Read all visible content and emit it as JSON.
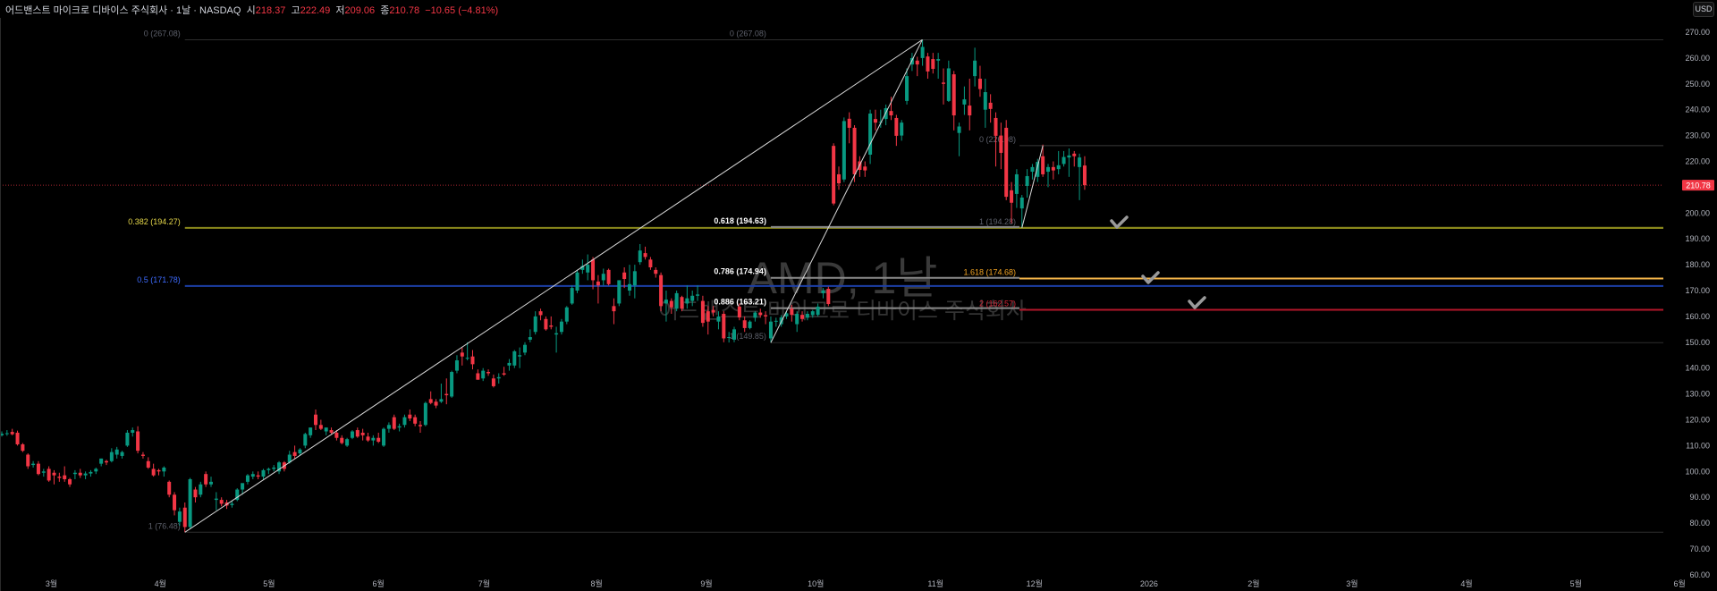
{
  "header": {
    "title": "어드밴스트 마이크로 디바이스 주식회사 · 1날 · NASDAQ",
    "open_label": "시",
    "open": "218.37",
    "high_label": "고",
    "high": "222.49",
    "low_label": "저",
    "low": "209.06",
    "close_label": "종",
    "close": "210.78",
    "change": "−10.65 (−4.81%)"
  },
  "currency_button": "USD",
  "watermark": {
    "symbol": "AMD, 1날",
    "name": "어드밴스트 마이크로 디바이스 주식회사"
  },
  "colors": {
    "up": "#089981",
    "down": "#f23645",
    "background": "#000000"
  },
  "chart_data": {
    "type": "candlestick",
    "symbol": "AMD",
    "interval": "1D",
    "exchange": "NASDAQ",
    "ylim": [
      60,
      270
    ],
    "y_ticks": [
      "270.00",
      "260.00",
      "250.00",
      "240.00",
      "230.00",
      "220.00",
      "210.00",
      "200.00",
      "190.00",
      "180.00",
      "170.00",
      "160.00",
      "150.00",
      "140.00",
      "130.00",
      "120.00",
      "110.00",
      "100.00",
      "90.00",
      "80.00",
      "70.00",
      "60.00"
    ],
    "x_ticks": [
      {
        "label": "3월",
        "index": 9.5
      },
      {
        "label": "4월",
        "index": 30.3
      },
      {
        "label": "5월",
        "index": 51.1
      },
      {
        "label": "6월",
        "index": 72
      },
      {
        "label": "7월",
        "index": 92.2
      },
      {
        "label": "8월",
        "index": 113.7
      },
      {
        "label": "9월",
        "index": 134.7
      },
      {
        "label": "10월",
        "index": 155.6
      },
      {
        "label": "11월",
        "index": 178.5
      },
      {
        "label": "12월",
        "index": 197.4
      },
      {
        "label": "2026",
        "index": 219.3
      },
      {
        "label": "2월",
        "index": 239.3
      },
      {
        "label": "3월",
        "index": 258.1
      },
      {
        "label": "4월",
        "index": 280
      },
      {
        "label": "5월",
        "index": 300.9
      },
      {
        "label": "6월",
        "index": 320.7
      }
    ],
    "last_price": "210.78",
    "candles_ohlc": [
      [
        114,
        115.5,
        113.5,
        114.6
      ],
      [
        114.6,
        116,
        113.8,
        114.8
      ],
      [
        115.3,
        116.5,
        114,
        114.4
      ],
      [
        115,
        115.8,
        110,
        110.5
      ],
      [
        110.5,
        111,
        107.5,
        108
      ],
      [
        106.5,
        107,
        101,
        102
      ],
      [
        102.5,
        104,
        101.5,
        103
      ],
      [
        103,
        104,
        98.5,
        99
      ],
      [
        99.5,
        101,
        98,
        100
      ],
      [
        101,
        102,
        96,
        96.5
      ],
      [
        99.5,
        100.5,
        95,
        98.5
      ],
      [
        98,
        99.5,
        96,
        97.5
      ],
      [
        98.5,
        102,
        96,
        97
      ],
      [
        97,
        97.5,
        94,
        95
      ],
      [
        99,
        100.5,
        97,
        99.5
      ],
      [
        99.5,
        101,
        97.5,
        98.5
      ],
      [
        98.5,
        100,
        97,
        99.2
      ],
      [
        99.2,
        100.5,
        98,
        99.8
      ],
      [
        100,
        101.5,
        99,
        101
      ],
      [
        103,
        105,
        102,
        105
      ],
      [
        104,
        104.5,
        102.5,
        103.5
      ],
      [
        104,
        109,
        103.5,
        107.5
      ],
      [
        106.5,
        109.5,
        105,
        108.5
      ],
      [
        106,
        108,
        105,
        107.5
      ],
      [
        110,
        116,
        109.5,
        115
      ],
      [
        115,
        117,
        113.5,
        116
      ],
      [
        115.5,
        117.5,
        107,
        108
      ],
      [
        106.5,
        107.5,
        105,
        106
      ],
      [
        104,
        105.5,
        101,
        101.5
      ],
      [
        101,
        103,
        98,
        98.5
      ],
      [
        100.5,
        101,
        98.5,
        100
      ],
      [
        100,
        102,
        98,
        101.5
      ],
      [
        96,
        96.5,
        90,
        91
      ],
      [
        91,
        92,
        83,
        85
      ],
      [
        80.5,
        86,
        79,
        84.5
      ],
      [
        86,
        88,
        76.48,
        78.5
      ],
      [
        78.5,
        97.5,
        78,
        97
      ],
      [
        93,
        94,
        88,
        90
      ],
      [
        91,
        96,
        90,
        95
      ],
      [
        99,
        100,
        94,
        95
      ],
      [
        95,
        98,
        94,
        96
      ],
      [
        89,
        92,
        85,
        89.5
      ],
      [
        89,
        90,
        86.5,
        87.5
      ],
      [
        88,
        89,
        85.5,
        86.8
      ],
      [
        87,
        88.5,
        86,
        87.5
      ],
      [
        89,
        93.5,
        88.5,
        93
      ],
      [
        93,
        95,
        91,
        95.5
      ],
      [
        96,
        99,
        95,
        98.5
      ],
      [
        98,
        100,
        97,
        99
      ],
      [
        98.5,
        100,
        97,
        98
      ],
      [
        98,
        101,
        97,
        100.5
      ],
      [
        100.5,
        101.5,
        99,
        101
      ],
      [
        101,
        102.5,
        100,
        101.5
      ],
      [
        100,
        104,
        99,
        103.5
      ],
      [
        103.5,
        104,
        100,
        101
      ],
      [
        103.5,
        108,
        103,
        106.5
      ],
      [
        107.5,
        110,
        105,
        106
      ],
      [
        107,
        109,
        106,
        108.5
      ],
      [
        110,
        115,
        109,
        114.5
      ],
      [
        114,
        117,
        113,
        117
      ],
      [
        122,
        124,
        116,
        118
      ],
      [
        118,
        120,
        116,
        116.5
      ],
      [
        115.5,
        117,
        114,
        117
      ],
      [
        116,
        117,
        114.5,
        115
      ],
      [
        115,
        116,
        112,
        113
      ],
      [
        113,
        114,
        110.5,
        111
      ],
      [
        110,
        113,
        109.5,
        112.5
      ],
      [
        113,
        116,
        112.5,
        115.5
      ],
      [
        116,
        117,
        113,
        113.5
      ],
      [
        115,
        116.5,
        112,
        114
      ],
      [
        113.5,
        115,
        111.5,
        112
      ],
      [
        112,
        114,
        110,
        113
      ],
      [
        113,
        115,
        111,
        111.5
      ],
      [
        110,
        117,
        109.5,
        116.5
      ],
      [
        116.5,
        119,
        115,
        118
      ],
      [
        121,
        122,
        116,
        116.5
      ],
      [
        117,
        118.5,
        115.5,
        117.5
      ],
      [
        118,
        122,
        117,
        121
      ],
      [
        122,
        124,
        119.5,
        120.5
      ],
      [
        121,
        122,
        117.5,
        118.5
      ],
      [
        118,
        119.5,
        115,
        117.5
      ],
      [
        118,
        127,
        117.5,
        126.5
      ],
      [
        128,
        131,
        126,
        126.5
      ],
      [
        127,
        128,
        124.5,
        125.5
      ],
      [
        127,
        134,
        126.5,
        128
      ],
      [
        130,
        136,
        126,
        129.5
      ],
      [
        129,
        139,
        128.5,
        138.5
      ],
      [
        139,
        145,
        138,
        143
      ],
      [
        146,
        148,
        141,
        144.5
      ],
      [
        144,
        150,
        143,
        144
      ],
      [
        144.5,
        147,
        139.5,
        141.5
      ],
      [
        138,
        139.5,
        135.5,
        135.5
      ],
      [
        136,
        140,
        135,
        139
      ],
      [
        138.5,
        139.5,
        137,
        138
      ],
      [
        136,
        137.5,
        132.5,
        133
      ],
      [
        136,
        138,
        134,
        136.5
      ],
      [
        138,
        140.5,
        137,
        137.5
      ],
      [
        141,
        143.5,
        139,
        142
      ],
      [
        141,
        147,
        140,
        146.5
      ],
      [
        144.5,
        148,
        140,
        145
      ],
      [
        146,
        150,
        145,
        149
      ],
      [
        151,
        155,
        150,
        152
      ],
      [
        154,
        162,
        153,
        160
      ],
      [
        162,
        163,
        158.5,
        160.5
      ],
      [
        159,
        160,
        154.5,
        155
      ],
      [
        156.5,
        160,
        155,
        156
      ],
      [
        153,
        156,
        146,
        153.5
      ],
      [
        154,
        159,
        153,
        158
      ],
      [
        158,
        164,
        157,
        163.5
      ],
      [
        165,
        172,
        164.5,
        171
      ],
      [
        170,
        178,
        169,
        177
      ],
      [
        178,
        182,
        176.5,
        179.5
      ],
      [
        177,
        184,
        174,
        180
      ],
      [
        182,
        183,
        170.5,
        174
      ],
      [
        173.5,
        176,
        165,
        172
      ],
      [
        174,
        178.5,
        172,
        176.5
      ],
      [
        178,
        178.5,
        172,
        172.5
      ],
      [
        164,
        167,
        157,
        162
      ],
      [
        165,
        174,
        164,
        174
      ],
      [
        177,
        179,
        171,
        174.5
      ],
      [
        170,
        180,
        168,
        172.5
      ],
      [
        172,
        180,
        167,
        177.5
      ],
      [
        181,
        188,
        180,
        185.5
      ],
      [
        184.5,
        187,
        182,
        183
      ],
      [
        182,
        183,
        178,
        179
      ],
      [
        178,
        179,
        175,
        176.5
      ],
      [
        176,
        177,
        162,
        164
      ],
      [
        165,
        170,
        158,
        166.5
      ],
      [
        166,
        167,
        161,
        163.5
      ],
      [
        163,
        170,
        162,
        169
      ],
      [
        167.5,
        168,
        162,
        163
      ],
      [
        165,
        172,
        163,
        167
      ],
      [
        166,
        170,
        164,
        168
      ],
      [
        168,
        172,
        166,
        168.5
      ],
      [
        166,
        168,
        156,
        157.5
      ],
      [
        162,
        164,
        153,
        158
      ],
      [
        162.5,
        164,
        160,
        161.5
      ],
      [
        158,
        162,
        155,
        160
      ],
      [
        161,
        162,
        150,
        151.5
      ],
      [
        152,
        154,
        149.9,
        152
      ],
      [
        151,
        156,
        150,
        155
      ],
      [
        163.8,
        165,
        158.5,
        159.6
      ],
      [
        158.5,
        160,
        154,
        155.5
      ],
      [
        155.5,
        158.5,
        155,
        158
      ],
      [
        159.5,
        162,
        158,
        161.5
      ],
      [
        161.5,
        163,
        159.5,
        160.5
      ],
      [
        160.5,
        162,
        157,
        160
      ],
      [
        151.5,
        160,
        149.85,
        158
      ],
      [
        158,
        159.5,
        156,
        158.3
      ],
      [
        157,
        160.5,
        156,
        159.6
      ],
      [
        160,
        162,
        159,
        161.2
      ],
      [
        163,
        164.5,
        158,
        160.6
      ],
      [
        157,
        162,
        154,
        161
      ],
      [
        160.6,
        162,
        158,
        159
      ],
      [
        159.5,
        162,
        158.5,
        161
      ],
      [
        160.5,
        162.5,
        159.5,
        162
      ],
      [
        160.6,
        165,
        160,
        163.8
      ],
      [
        169,
        171,
        167,
        170
      ],
      [
        170.7,
        171.5,
        164,
        164.8
      ],
      [
        226,
        227,
        203,
        203.7
      ],
      [
        215,
        218,
        209,
        211.5
      ],
      [
        213,
        237,
        212,
        235.6
      ],
      [
        236.5,
        239,
        227,
        233
      ],
      [
        233,
        234,
        212,
        215
      ],
      [
        220,
        222,
        214,
        216.7
      ],
      [
        218,
        220,
        214,
        216.5
      ],
      [
        222.6,
        240,
        219,
        238.5
      ],
      [
        236.4,
        240,
        232,
        235
      ],
      [
        235,
        240,
        233,
        235.3
      ],
      [
        236.4,
        242,
        234,
        240.6
      ],
      [
        239.5,
        245,
        236,
        237.8
      ],
      [
        236.8,
        238,
        226,
        229.9
      ],
      [
        230,
        236,
        228,
        235
      ],
      [
        243.4,
        256,
        242,
        253
      ],
      [
        257.5,
        262,
        255,
        260
      ],
      [
        259,
        260.5,
        253,
        257.5
      ],
      [
        260,
        267.08,
        257,
        264.3
      ],
      [
        260.6,
        262,
        252,
        254.8
      ],
      [
        259.6,
        262,
        254,
        255.8
      ],
      [
        259,
        262,
        252,
        259.6
      ],
      [
        250.5,
        256,
        242,
        250
      ],
      [
        243.4,
        259,
        243,
        256
      ],
      [
        253.7,
        255,
        232,
        237.8
      ],
      [
        231,
        235,
        222,
        233.5
      ],
      [
        242,
        249,
        238,
        244
      ],
      [
        241.6,
        252,
        232,
        237.8
      ],
      [
        253,
        264,
        249,
        259
      ],
      [
        252,
        257,
        245,
        248
      ],
      [
        240,
        252,
        233,
        246.8
      ],
      [
        242.7,
        246,
        235,
        240.3
      ],
      [
        236.8,
        239,
        218,
        229.9
      ],
      [
        230,
        235,
        217,
        223.3
      ],
      [
        233,
        236,
        205,
        206.3
      ],
      [
        208.8,
        212,
        196,
        204
      ],
      [
        207.4,
        217,
        202,
        215
      ],
      [
        201.8,
        207,
        194.28,
        206
      ],
      [
        210.5,
        217,
        206,
        214.3
      ],
      [
        216,
        219,
        213,
        217.8
      ],
      [
        214,
        221,
        212,
        219.8
      ],
      [
        222,
        226.5,
        214,
        215
      ],
      [
        216,
        219,
        210,
        217.8
      ],
      [
        217.8,
        220,
        213,
        216.5
      ],
      [
        217,
        224,
        215,
        218.5
      ],
      [
        219,
        224,
        218,
        221.7
      ],
      [
        221.5,
        225,
        214,
        222.3
      ],
      [
        223,
        224,
        218,
        222
      ],
      [
        217.8,
        223,
        205,
        221.5
      ],
      [
        218.4,
        222,
        209,
        210.78
      ]
    ],
    "fib_retracement_1": {
      "from": {
        "index": 35,
        "price": 76.48
      },
      "to": {
        "index": 176,
        "price": 267.08
      },
      "levels": [
        {
          "ratio": "0",
          "price": 267.08,
          "label": "0 (267.08)",
          "color": "#5d606b"
        },
        {
          "ratio": "0.382",
          "price": 194.27,
          "label": "0.382 (194.27)",
          "color": "#e6d84a"
        },
        {
          "ratio": "0.5",
          "price": 171.78,
          "label": "0.5 (171.78)",
          "color": "#3d6bff"
        },
        {
          "ratio": "1",
          "price": 76.48,
          "label": "1 (76.48)",
          "color": "#5d606b"
        }
      ]
    },
    "fib_retracement_2": {
      "from": {
        "index": 147,
        "price": 149.85
      },
      "to": {
        "index": 176,
        "price": 267.08
      },
      "levels": [
        {
          "ratio": "0",
          "price": 267.08,
          "label": "0 (267.08)",
          "color": "#5d606b"
        },
        {
          "ratio": "0.618",
          "price": 194.63,
          "label": "0.618 (194.63)",
          "color": "#ffffff"
        },
        {
          "ratio": "0.786",
          "price": 174.94,
          "label": "0.786 (174.94)",
          "color": "#ffffff"
        },
        {
          "ratio": "0.886",
          "price": 163.21,
          "label": "0.886 (163.21)",
          "color": "#ffffff"
        },
        {
          "ratio": "1",
          "price": 149.85,
          "label": "1 (149.85)",
          "color": "#5d606b"
        }
      ]
    },
    "fib_extension": {
      "from": {
        "index": 195,
        "price": 194.28
      },
      "to": {
        "index": 199,
        "price": 226.08
      },
      "levels": [
        {
          "ratio": "0",
          "price": 226.08,
          "label": "0 (226.08)",
          "color": "#5d606b"
        },
        {
          "ratio": "1",
          "price": 194.28,
          "label": "1 (194.28)",
          "color": "#5d606b"
        },
        {
          "ratio": "1.618",
          "price": 174.68,
          "label": "1.618 (174.68)",
          "color": "#f5a623"
        },
        {
          "ratio": "2",
          "price": 162.57,
          "label": "2 (162.57)",
          "color": "#d62839"
        }
      ]
    }
  }
}
